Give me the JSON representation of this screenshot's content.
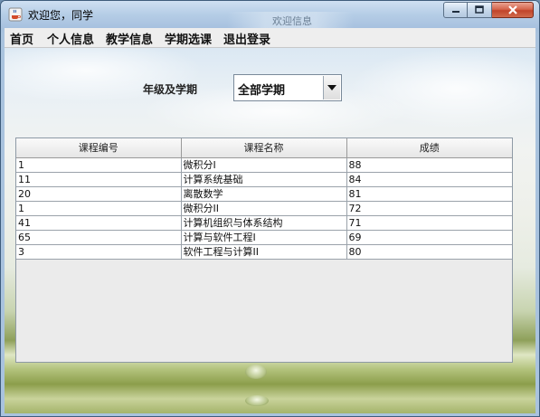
{
  "window": {
    "title": "欢迎您，同学",
    "background_hint": "欢迎信息",
    "icons": {
      "app": "java-cup-icon",
      "minimize": "minimize-icon",
      "maximize": "maximize-icon",
      "close": "close-icon"
    }
  },
  "menubar": {
    "items": [
      {
        "label": "首页"
      },
      {
        "label": "个人信息"
      },
      {
        "label": "教学信息"
      },
      {
        "label": "学期选课"
      },
      {
        "label": "退出登录"
      }
    ]
  },
  "filter": {
    "label": "年级及学期",
    "selected": "全部学期",
    "dropdown_icon": "chevron-down-icon"
  },
  "table": {
    "columns": [
      "课程编号",
      "课程名称",
      "成绩"
    ],
    "rows": [
      [
        "1",
        "微积分I",
        "88"
      ],
      [
        "11",
        "计算系统基础",
        "84"
      ],
      [
        "20",
        "离散数学",
        "81"
      ],
      [
        "1",
        "微积分II",
        "72"
      ],
      [
        "41",
        "计算机组织与体系结构",
        "71"
      ],
      [
        "65",
        "计算与软件工程I",
        "69"
      ],
      [
        "3",
        "软件工程与计算II",
        "80"
      ]
    ]
  },
  "colors": {
    "titlebar": "#b5cde6",
    "close_button": "#c1442a",
    "menubar": "#eeeeee",
    "table_header": "#e6e6e6"
  }
}
